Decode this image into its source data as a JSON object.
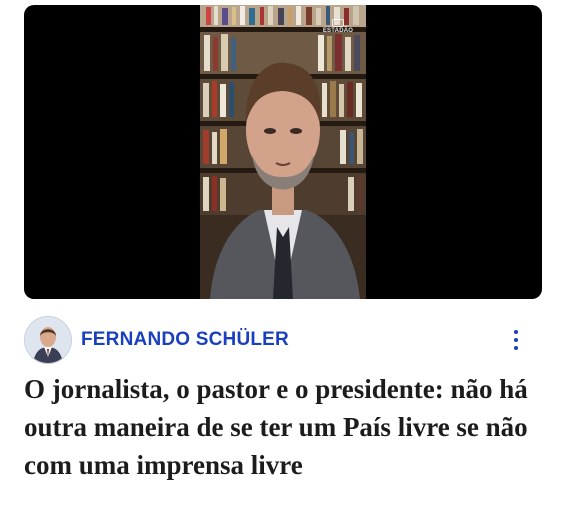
{
  "video": {
    "watermark": "ESTADÃO"
  },
  "article": {
    "author_name": "FERNANDO SCHÜLER",
    "headline": "O jornalista, o pastor e o presidente: não há outra maneira de se ter um País livre se não com uma imprensa livre"
  },
  "icons": {
    "more": "more-vertical-icon",
    "avatar": "author-avatar"
  },
  "colors": {
    "accent": "#1a3fbf",
    "video_background": "#000000",
    "headline": "#1c1c1c"
  }
}
